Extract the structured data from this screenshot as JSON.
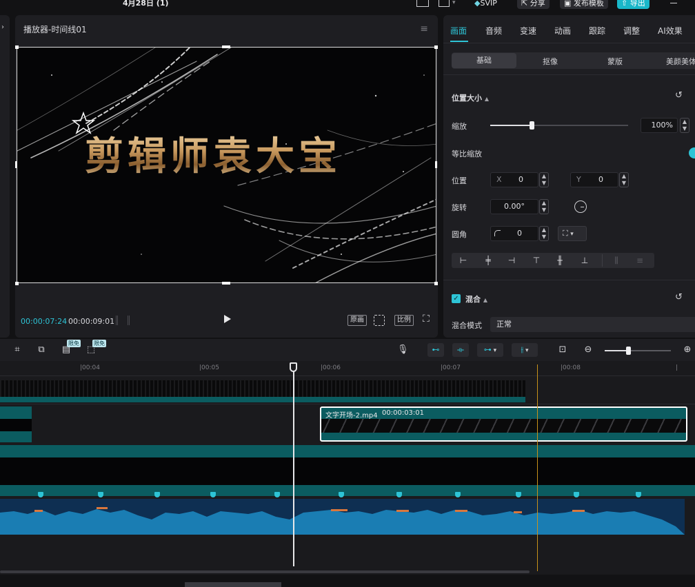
{
  "topbar": {
    "title": "4月28日 (1)",
    "svip": "SVIP",
    "share": "分享",
    "publish_template": "发布模板",
    "export": "导出"
  },
  "player": {
    "title": "播放器-时间线01",
    "canvas_text": "剪辑师袁大宝",
    "current_time": "00:00:07:24",
    "total_time": "00:00:09:01",
    "original_btn": "原画",
    "ratio_btn": "比例"
  },
  "inspector": {
    "tabs": [
      "画面",
      "音频",
      "变速",
      "动画",
      "跟踪",
      "调整",
      "AI效果"
    ],
    "subtabs": [
      "基础",
      "抠像",
      "蒙版",
      "美颜美体"
    ],
    "position_size_title": "位置大小",
    "scale_label": "缩放",
    "scale_value": "100%",
    "scale_level": 0.3,
    "uniform_scale_label": "等比缩放",
    "position_label": "位置",
    "x_label": "X",
    "x_value": "0",
    "y_label": "Y",
    "y_value": "0",
    "rotation_label": "旋转",
    "rotation_value": "0.00°",
    "corner_label": "圆角",
    "corner_value": "0",
    "blend_title": "混合",
    "blend_mode_label": "混合模式",
    "blend_mode_value": "正常"
  },
  "toolbar": {
    "badge1": "限免",
    "badge2": "限免"
  },
  "timeline": {
    "ticks": [
      "00:04",
      "00:05",
      "00:06",
      "00:07",
      "00:08"
    ],
    "clip_name": "文字开场-2.mp4",
    "clip_duration": "00:00:03:01"
  },
  "colors": {
    "accent": "#2ec4d6",
    "track_teal": "#0b5c60",
    "audio_blue": "#1a7db3",
    "playhead_orange": "#c9921a"
  }
}
